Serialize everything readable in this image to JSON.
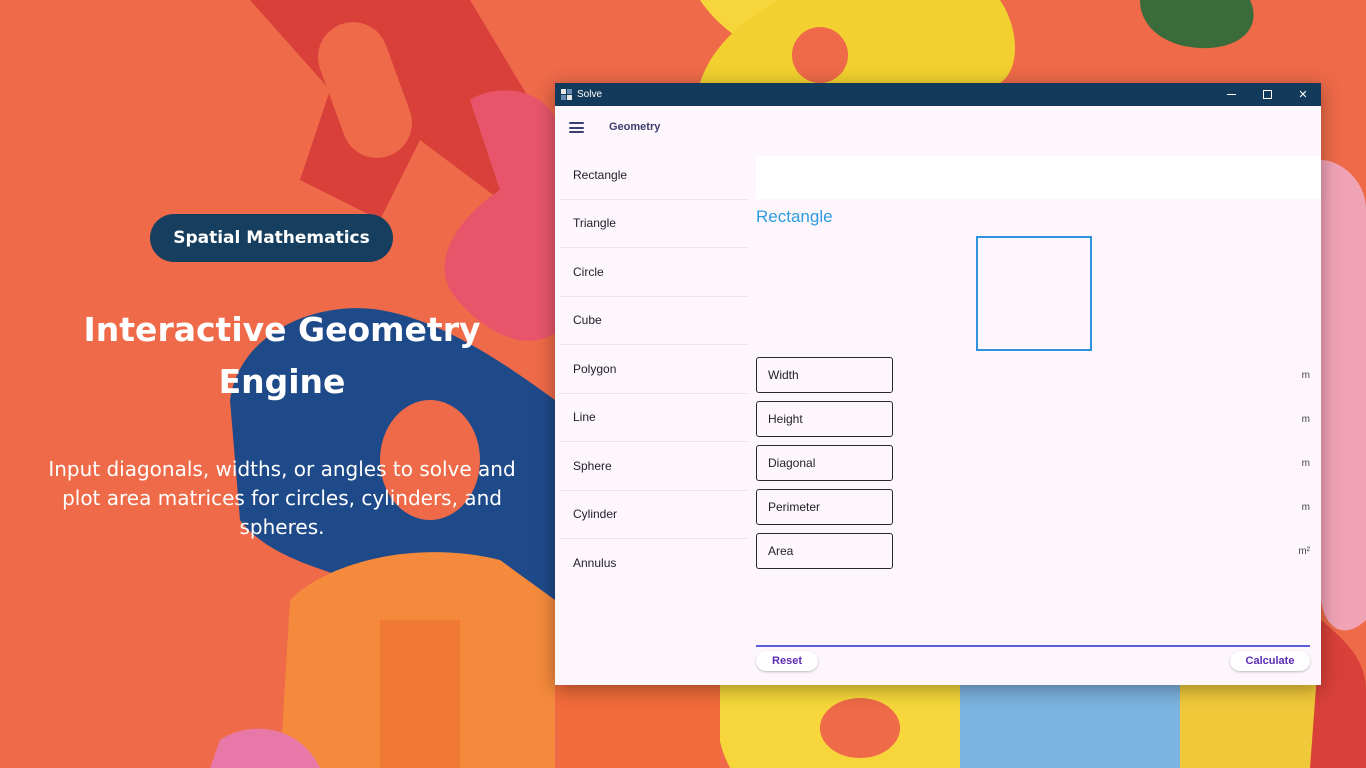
{
  "promo": {
    "badge": "Spatial Mathematics",
    "title": "Interactive Geometry Engine",
    "description": "Input diagonals, widths, or angles to solve and plot area matrices for circles, cylinders, and spheres."
  },
  "window": {
    "title": "Solve",
    "controls": {
      "minimize": "",
      "maximize": "",
      "close": "✕"
    }
  },
  "appbar": {
    "title": "Geometry"
  },
  "sidebar": {
    "items": [
      {
        "label": "Rectangle"
      },
      {
        "label": "Triangle"
      },
      {
        "label": "Circle"
      },
      {
        "label": "Cube"
      },
      {
        "label": "Polygon"
      },
      {
        "label": "Line"
      },
      {
        "label": "Sphere"
      },
      {
        "label": "Cylinder"
      },
      {
        "label": "Annulus"
      }
    ]
  },
  "content": {
    "shape_title": "Rectangle",
    "fields": [
      {
        "placeholder": "Width",
        "value": "",
        "unit": "m"
      },
      {
        "placeholder": "Height",
        "value": "",
        "unit": "m"
      },
      {
        "placeholder": "Diagonal",
        "value": "",
        "unit": "m"
      },
      {
        "placeholder": "Perimeter",
        "value": "",
        "unit": "m"
      },
      {
        "placeholder": "Area",
        "value": "",
        "unit": "m²"
      }
    ],
    "reset_label": "Reset",
    "calculate_label": "Calculate"
  },
  "colors": {
    "background": "#ee6a48",
    "badge": "#163f5f",
    "titlebar": "#133a5a",
    "accent_blue": "#2d9be0",
    "button_text": "#5c2bb5",
    "divider": "#5b5fd9"
  }
}
